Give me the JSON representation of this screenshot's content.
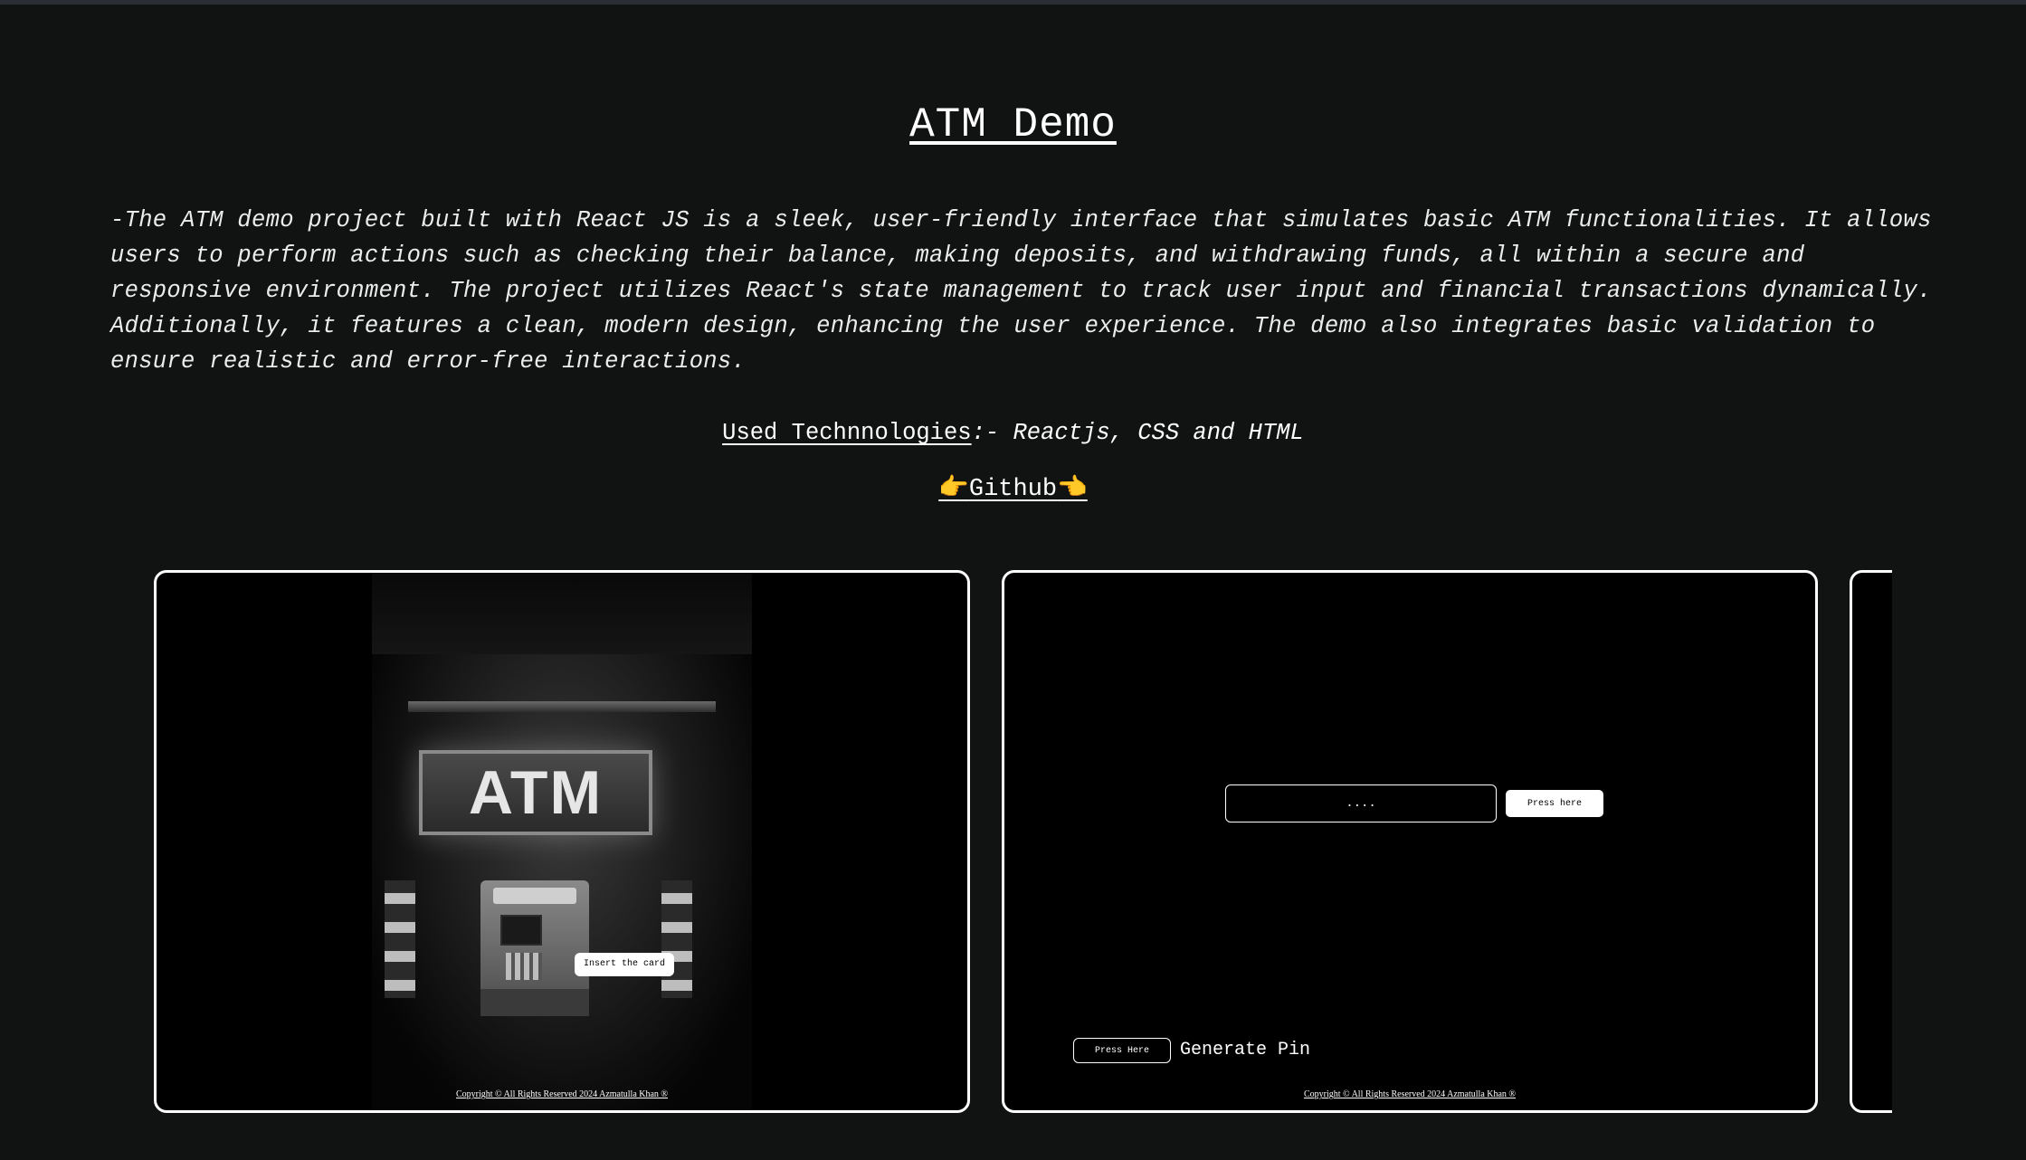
{
  "page": {
    "title": "ATM Demo",
    "description": "-The ATM demo project built with React JS is a sleek, user-friendly interface that simulates basic ATM functionalities. It allows users to perform actions such as checking their balance, making deposits, and withdrawing funds, all within a secure and responsive environment. The project utilizes React's state management to track user input and financial transactions dynamically. Additionally, it features a clean, modern design, enhancing the user experience. The demo also integrates basic validation to ensure realistic and error-free interactions.",
    "tech_label": "Used Technnologies",
    "tech_value": ":- Reactjs, CSS and HTML",
    "github_label": "Github",
    "github_hand_left": "👉",
    "github_hand_right": "👈"
  },
  "cards": [
    {
      "image_sign_text": "ATM",
      "button_label": "Insert the card",
      "copyright": "Copyright © All Rights Reserved 2024 Azmatulla Khan ®"
    },
    {
      "pin_input_value": "....",
      "press_button_label": "Press here",
      "generate_button_label": "Press Here",
      "generate_label": "Generate Pin",
      "copyright": "Copyright © All Rights Reserved 2024 Azmatulla Khan ®"
    }
  ],
  "colors": {
    "background": "#111313",
    "card_background": "#000000",
    "card_border": "#ffffff",
    "text": "#ffffff"
  }
}
